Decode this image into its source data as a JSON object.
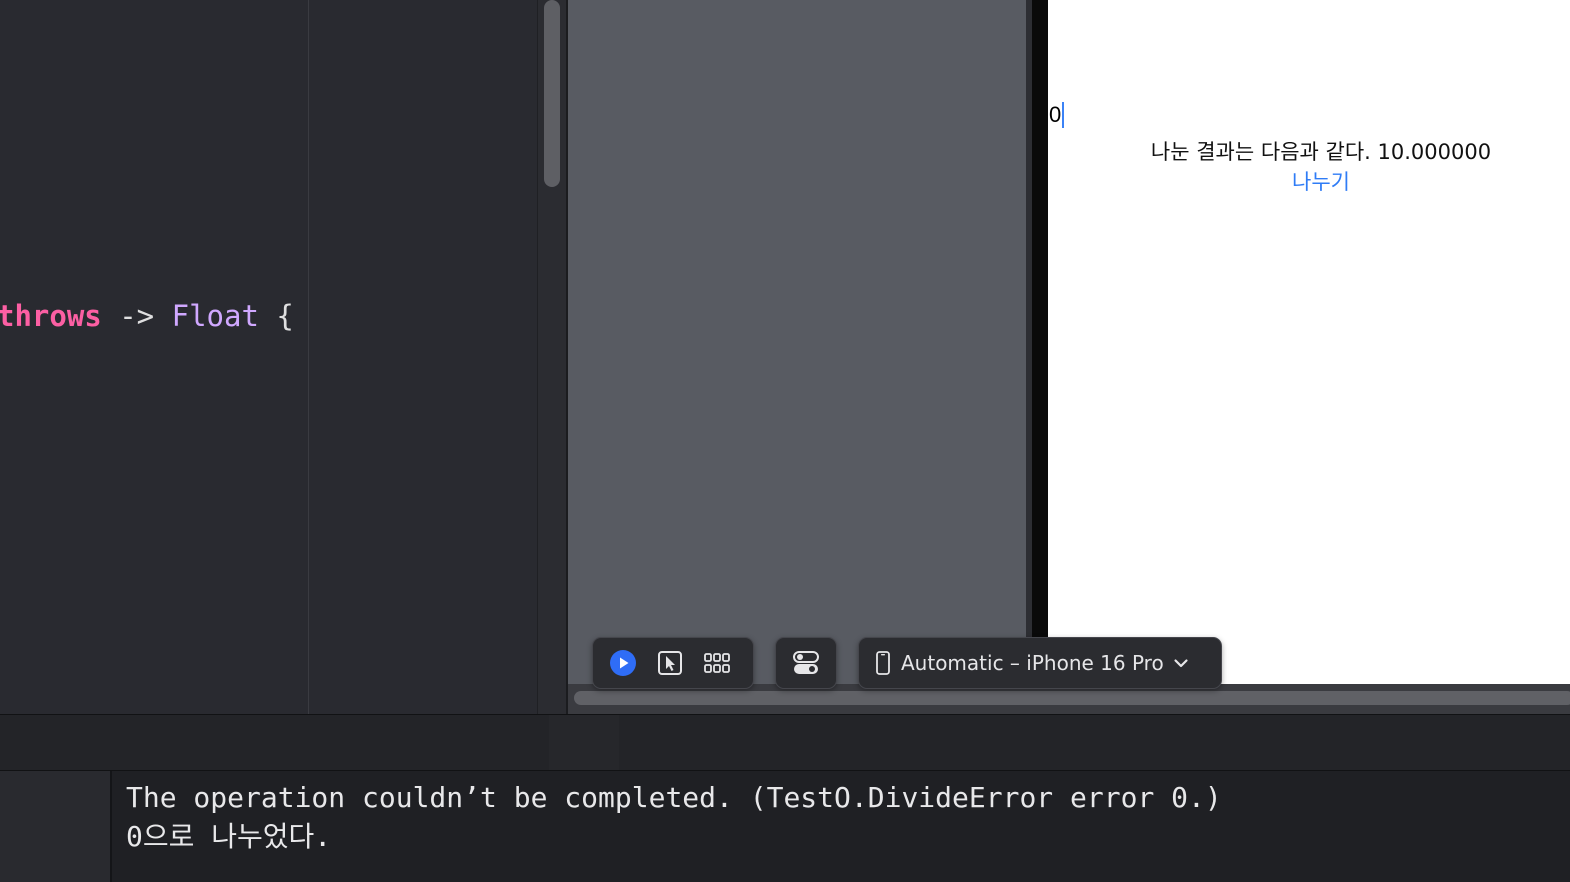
{
  "editor": {
    "code_tokens": {
      "kw_throws": "throws",
      "arrow": " -> ",
      "type_float": "Float",
      "brace": " {"
    }
  },
  "preview": {
    "text_field_value": "0",
    "result_text": "나눈 결과는 다음과 같다. 10.000000",
    "divide_button_label": "나누기"
  },
  "canvas_toolbar": {
    "device_label": "Automatic – iPhone 16 Pro",
    "colors": {
      "live_accent": "#2f6df6",
      "icon": "#e6e6e8"
    }
  },
  "console": {
    "lines": [
      "The operation couldn’t be completed. (TestO.DivideError error 0.)",
      "0으로 나누었다."
    ]
  },
  "colors": {
    "editor_bg": "#292a30",
    "keyword": "#fc5fa3",
    "type": "#d0a8ff",
    "canvas_bg": "#585b62",
    "link_blue": "#2f7cf6"
  }
}
